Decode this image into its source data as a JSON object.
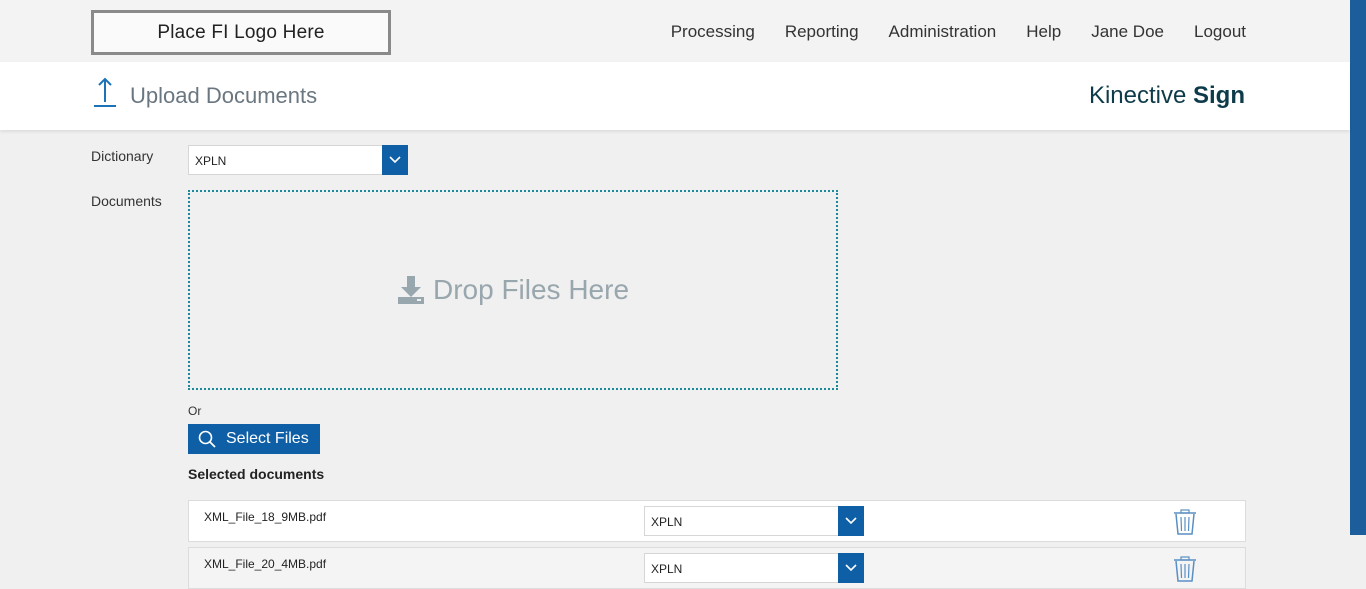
{
  "logo": {
    "text": "Place FI Logo Here"
  },
  "nav": {
    "items": [
      "Processing",
      "Reporting",
      "Administration",
      "Help",
      "Jane Doe",
      "Logout"
    ]
  },
  "header": {
    "title": "Upload Documents",
    "brand_light": "Kinective",
    "brand_bold": "Sign"
  },
  "form": {
    "dictionary_label": "Dictionary",
    "dictionary_value": "XPLN",
    "documents_label": "Documents",
    "drop_text": "Drop Files Here",
    "or_text": "Or",
    "select_files_label": "Select Files",
    "selected_title": "Selected documents"
  },
  "documents": [
    {
      "name": "XML_File_18_9MB.pdf",
      "dictionary": "XPLN"
    },
    {
      "name": "XML_File_20_4MB.pdf",
      "dictionary": "XPLN"
    }
  ],
  "colors": {
    "accent": "#0e5fa6",
    "brand": "#0e3b4a",
    "dropzone_border": "#1a8a9a",
    "muted_text": "#98a6ad"
  },
  "icons": {
    "upload": "upload-arrow-icon",
    "download": "download-tray-icon",
    "search": "search-icon",
    "trash": "trash-icon",
    "chevron": "chevron-down-icon"
  }
}
